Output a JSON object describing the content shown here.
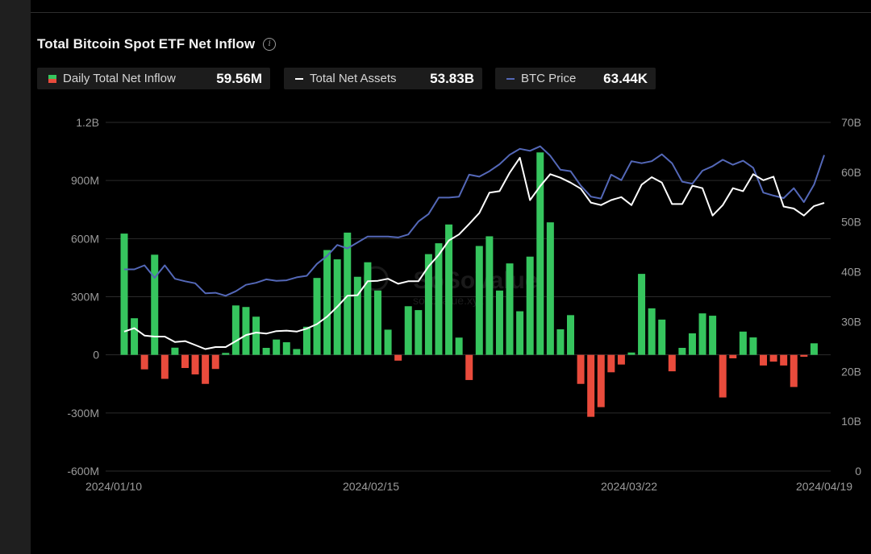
{
  "header": {
    "title": "Total Bitcoin Spot ETF Net Inflow",
    "info_icon": "info-icon"
  },
  "legend": [
    {
      "label": "Daily Total Net Inflow",
      "value": "59.56M"
    },
    {
      "label": "Total Net Assets",
      "value": "53.83B"
    },
    {
      "label": "BTC Price",
      "value": "63.44K"
    }
  ],
  "watermark": {
    "brand": "SoSoValue",
    "site": "sosovalue.xyz"
  },
  "colors": {
    "positive": "#36c55e",
    "negative": "#e94b3c",
    "assets_line": "#ffffff",
    "price_line": "#5468b8",
    "grid": "#2b2b2b"
  },
  "chart_data": {
    "type": "bar",
    "title": "Total Bitcoin Spot ETF Net Inflow",
    "grid": true,
    "left_axis": {
      "ticks": [
        "-600M",
        "-300M",
        "0",
        "300M",
        "600M",
        "900M",
        "1.2B"
      ],
      "ylim": [
        -600,
        1200
      ],
      "unit": "M USD"
    },
    "right_axis": {
      "ticks": [
        "0",
        "10B",
        "20B",
        "30B",
        "40B",
        "50B",
        "60B",
        "70B"
      ],
      "ylim": [
        0,
        70
      ],
      "unit": "B USD"
    },
    "x_tick_labels": [
      "2024/01/10",
      "2024/02/15",
      "2024/03/22",
      "2024/04/19"
    ],
    "series": [
      {
        "name": "Daily Total Net Inflow",
        "type": "bar",
        "axis": "left",
        "values": [
          626,
          189,
          -75,
          517,
          -124,
          37,
          -68,
          -101,
          -150,
          -73,
          10,
          255,
          247,
          197,
          36,
          79,
          65,
          30,
          145,
          397,
          541,
          493,
          631,
          403,
          478,
          332,
          130,
          -30,
          251,
          231,
          520,
          576,
          673,
          89,
          -130,
          562,
          612,
          332,
          472,
          225,
          507,
          1045,
          684,
          132,
          205,
          -150,
          -320,
          -270,
          -90,
          -50,
          12,
          418,
          240,
          182,
          -85,
          36,
          111,
          214,
          202,
          -220,
          -18,
          120,
          90,
          -55,
          -35,
          -55,
          -166,
          -10,
          59.56
        ]
      },
      {
        "name": "Total Net Assets",
        "type": "line",
        "axis": "right",
        "values": [
          28,
          28.7,
          27.2,
          27,
          27,
          25.9,
          26.1,
          25.3,
          24.5,
          24.9,
          24.9,
          26.1,
          27.3,
          27.8,
          27.6,
          28.1,
          28.2,
          28,
          28.6,
          29.5,
          31,
          33,
          35.2,
          35.3,
          38.1,
          38.2,
          38.6,
          37.6,
          38.1,
          38.1,
          41.1,
          43.4,
          46.3,
          47.5,
          49.6,
          51.8,
          55.9,
          56.2,
          59.9,
          62.9,
          54.4,
          57.2,
          59.6,
          58.9,
          57.9,
          56.7,
          53.9,
          53.4,
          54.4,
          55,
          53.4,
          57.5,
          59,
          57.9,
          53.6,
          53.6,
          57.3,
          56.8,
          51.3,
          53.4,
          56.8,
          56.2,
          59.6,
          58.4,
          59.1,
          53.1,
          52.7,
          51.3,
          53.2,
          53.83
        ]
      },
      {
        "name": "BTC Price",
        "type": "line",
        "axis": "right",
        "values": [
          40.5,
          40.5,
          41.3,
          38.8,
          41.3,
          38.6,
          38.1,
          37.7,
          35.7,
          35.8,
          35.2,
          36.1,
          37.4,
          37.8,
          38.5,
          38.2,
          38.3,
          38.9,
          39.2,
          41.6,
          43.2,
          45.4,
          44.7,
          45.9,
          47.1,
          47.1,
          47.1,
          46.9,
          47.5,
          50.1,
          51.6,
          54.9,
          54.9,
          55.1,
          59.5,
          59.1,
          60.2,
          61.6,
          63.5,
          64.7,
          64.3,
          65.2,
          63.3,
          60.5,
          60.2,
          57.3,
          55.1,
          54.7,
          59.5,
          58.4,
          62.2,
          61.8,
          62.2,
          63.6,
          61.8,
          58.1,
          57.7,
          60.3,
          61.2,
          62.5,
          61.5,
          62.3,
          60.9,
          55.9,
          55.3,
          54.8,
          56.8,
          54,
          57.5,
          63.44
        ]
      }
    ]
  }
}
